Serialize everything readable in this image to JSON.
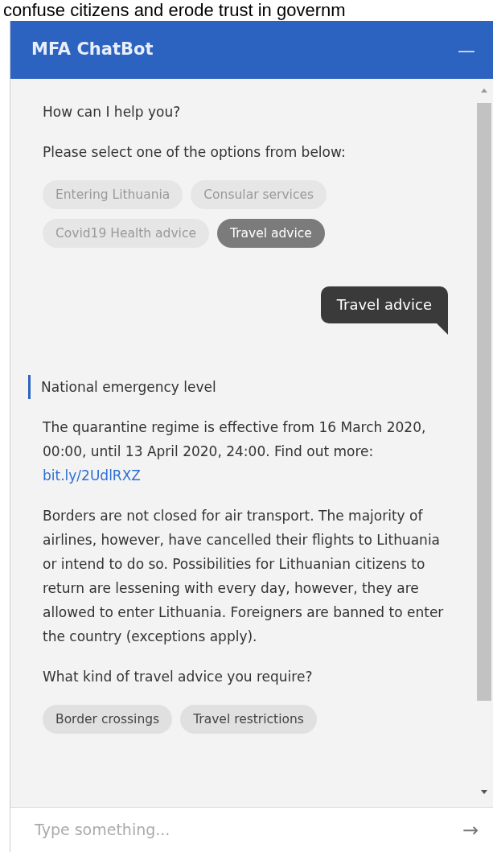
{
  "background_text": "confuse citizens and erode trust in governm",
  "window": {
    "title": "MFA ChatBot",
    "minimize": "—"
  },
  "messages": [
    {
      "kind": "bot",
      "text": "How can I help you?"
    },
    {
      "kind": "bot",
      "text": "Please select one of the options from below:"
    },
    {
      "kind": "options",
      "answered": true,
      "options": [
        {
          "label": "Entering Lithuania",
          "selected": false
        },
        {
          "label": "Consular services",
          "selected": false
        },
        {
          "label": "Covid19 Health advice",
          "selected": false
        },
        {
          "label": "Travel advice",
          "selected": true
        }
      ]
    },
    {
      "kind": "user",
      "text": "Travel advice"
    },
    {
      "kind": "heading",
      "text": "National emergency level"
    },
    {
      "kind": "bot",
      "text": "The quarantine regime is effective from 16 March 2020, 00:00, until 13 April 2020, 24:00. Find out more:",
      "link": "bit.ly/2UdlRXZ"
    },
    {
      "kind": "bot",
      "text": "Borders are not closed for air transport. The majority of airlines, however, have cancelled their flights to Lithuania or intend to do so. Possibilities for Lithuanian citizens to return are lessening with every day, however, they are allowed to enter Lithuania. Foreigners are banned to enter the country (exceptions apply)."
    },
    {
      "kind": "bot",
      "text": "What kind of travel advice you require?"
    },
    {
      "kind": "options",
      "answered": false,
      "options": [
        {
          "label": "Border crossings",
          "selected": false
        },
        {
          "label": "Travel restrictions",
          "selected": false
        }
      ]
    }
  ],
  "input": {
    "placeholder": "Type something...",
    "send": "→"
  }
}
